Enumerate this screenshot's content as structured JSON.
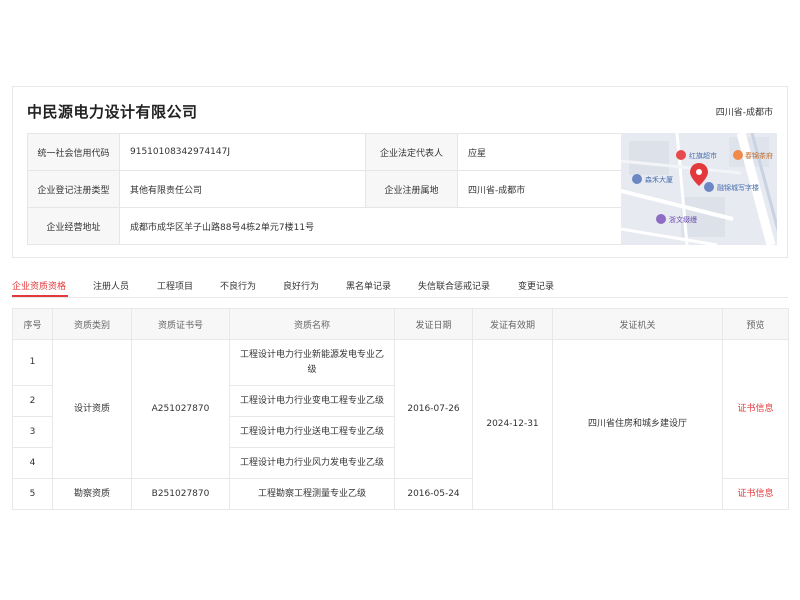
{
  "company": {
    "name": "中民源电力设计有限公司",
    "region": "四川省-成都市"
  },
  "info": {
    "credit_code_label": "统一社会信用代码",
    "credit_code": "91510108342974147J",
    "legal_rep_label": "企业法定代表人",
    "legal_rep": "应星",
    "reg_type_label": "企业登记注册类型",
    "reg_type": "其他有限责任公司",
    "reg_place_label": "企业注册属地",
    "reg_place": "四川省-成都市",
    "address_label": "企业经营地址",
    "address": "成都市成华区羊子山路88号4栋2单元7楼11号"
  },
  "map": {
    "poi": [
      "红旗超市",
      "春锦茶府",
      "森禾大厦",
      "融锦城写字楼",
      "浙文缀缦"
    ]
  },
  "tabs": [
    {
      "label": "企业资质资格"
    },
    {
      "label": "注册人员"
    },
    {
      "label": "工程项目"
    },
    {
      "label": "不良行为"
    },
    {
      "label": "良好行为"
    },
    {
      "label": "黑名单记录"
    },
    {
      "label": "失信联合惩戒记录"
    },
    {
      "label": "变更记录"
    }
  ],
  "table": {
    "headers": [
      "序号",
      "资质类别",
      "资质证书号",
      "资质名称",
      "发证日期",
      "发证有效期",
      "发证机关",
      "预览"
    ],
    "group1": {
      "category": "设计资质",
      "cert_no": "A251027870",
      "issue_date": "2016-07-26",
      "rows": [
        {
          "no": "1",
          "name": "工程设计电力行业新能源发电专业乙级"
        },
        {
          "no": "2",
          "name": "工程设计电力行业变电工程专业乙级"
        },
        {
          "no": "3",
          "name": "工程设计电力行业送电工程专业乙级"
        },
        {
          "no": "4",
          "name": "工程设计电力行业风力发电专业乙级"
        }
      ],
      "preview": "证书信息"
    },
    "group2": {
      "no": "5",
      "category": "勘察资质",
      "cert_no": "B251027870",
      "name": "工程勘察工程测量专业乙级",
      "issue_date": "2016-05-24",
      "preview": "证书信息"
    },
    "validity": "2024-12-31",
    "authority": "四川省住房和城乡建设厅"
  }
}
